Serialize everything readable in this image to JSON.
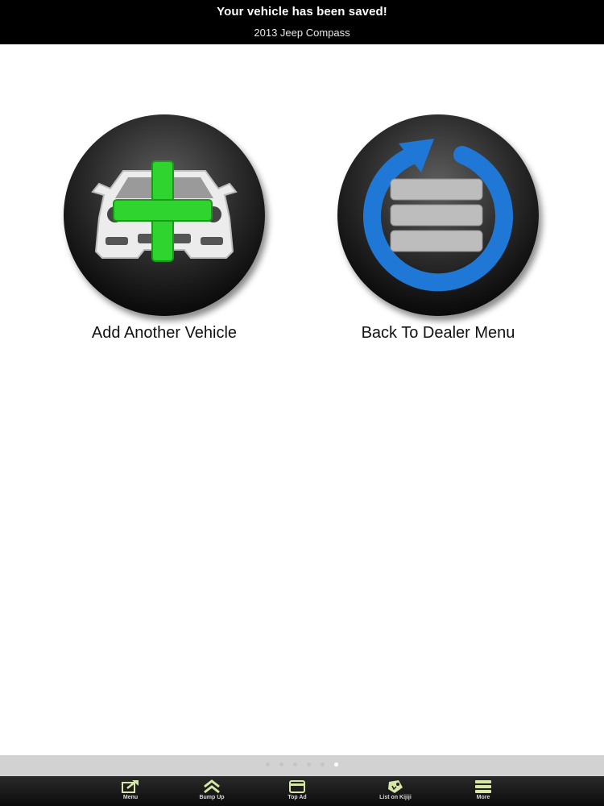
{
  "header": {
    "title": "Your vehicle has been saved!",
    "subtitle": "2013 Jeep Compass"
  },
  "actions": [
    {
      "label": "Add Another Vehicle",
      "icon": "car-plus-icon",
      "accent": "#2fd42f"
    },
    {
      "label": "Back To Dealer Menu",
      "icon": "circular-arrow-menu-icon",
      "accent": "#1f78d6"
    }
  ],
  "page_indicator": {
    "total": 6,
    "current": 6
  },
  "tabbar": {
    "icon_color": "#d6e6a6",
    "items": [
      {
        "label": "Menu",
        "icon": "share-icon"
      },
      {
        "label": "Bump Up",
        "icon": "chevron-up-icon"
      },
      {
        "label": "Top Ad",
        "icon": "card-icon"
      },
      {
        "label": "List on Kijiji",
        "icon": "tag-icon"
      },
      {
        "label": "More",
        "icon": "hamburger-icon"
      }
    ]
  }
}
